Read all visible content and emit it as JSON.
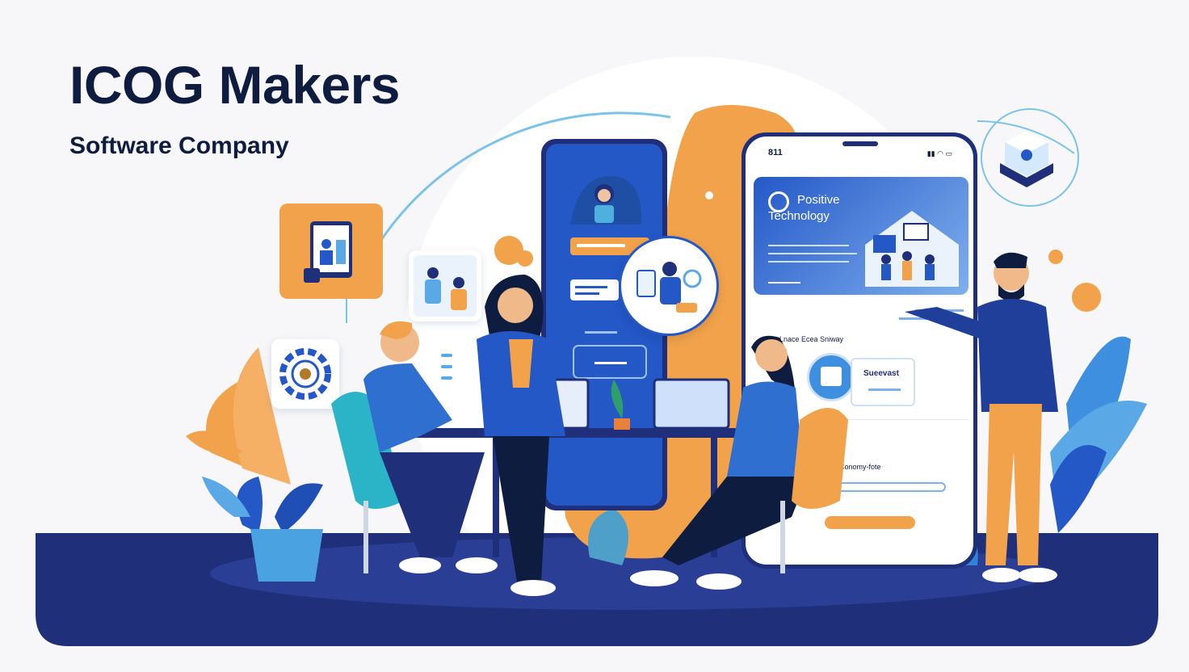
{
  "brand": {
    "title": "ICOG Makers",
    "subtitle": "Software Company"
  },
  "right_phone": {
    "status_time": "811",
    "banner_title_line1": "Positive",
    "banner_title_line2": "Technology",
    "section_label": "Lnace Ecea Sniway",
    "feature_label": "Sueevast",
    "footer_label": "Conomy-fote"
  },
  "colors": {
    "navy": "#1f2f7a",
    "blue": "#2458c7",
    "orange": "#f2a24a",
    "light_blue": "#5aa9e6",
    "title_text": "#0d1c3f"
  },
  "icons": [
    "tablet-illustration-icon",
    "gear-illustration-icon",
    "cube-icon",
    "calendar-icon",
    "plant-icon"
  ]
}
